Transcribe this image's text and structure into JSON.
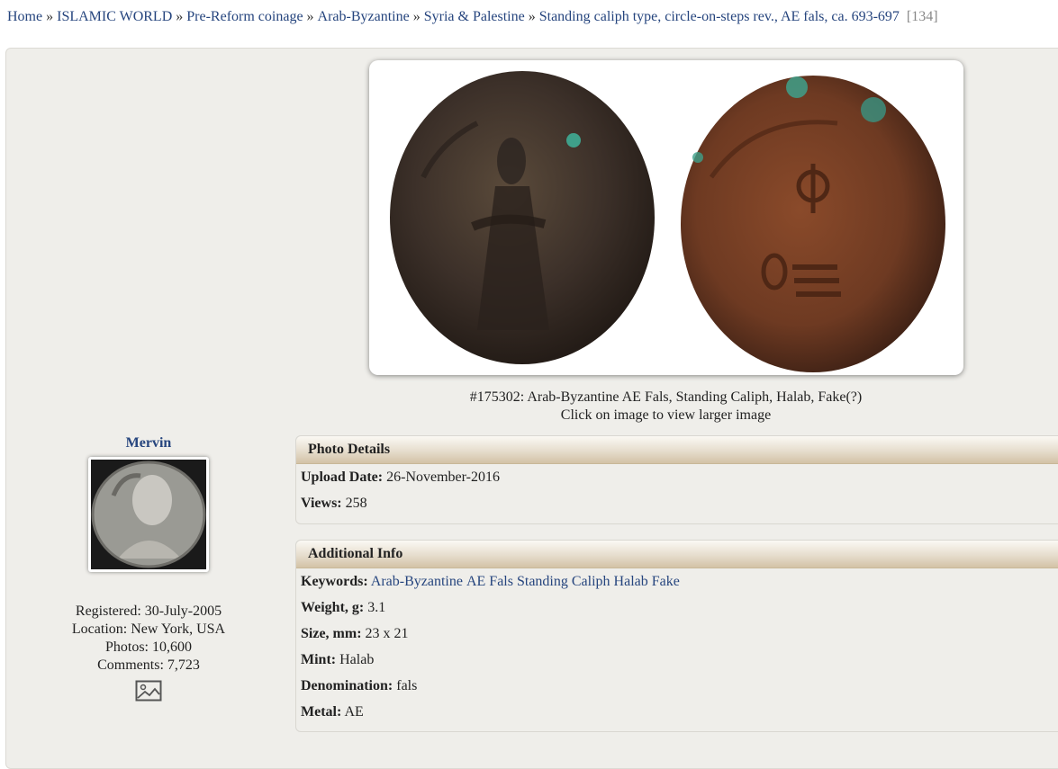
{
  "breadcrumb": {
    "items": [
      "Home",
      "ISLAMIC WORLD",
      "Pre-Reform coinage",
      "Arab-Byzantine",
      "Syria & Palestine",
      "Standing caliph type, circle-on-steps rev., AE fals, ca. 693-697"
    ],
    "separator": "»",
    "count": "[134]"
  },
  "photo": {
    "caption": "#175302: Arab-Byzantine AE Fals, Standing Caliph, Halab, Fake(?)",
    "hint": "Click on image to view larger image"
  },
  "user": {
    "name": "Mervin",
    "registered": "Registered: 30-July-2005",
    "location": "Location: New York, USA",
    "photos": "Photos: 10,600",
    "comments": "Comments: 7,723"
  },
  "photo_details": {
    "title": "Photo Details",
    "upload_label": "Upload Date:",
    "upload_value": "26-November-2016",
    "views_label": "Views:",
    "views_value": "258"
  },
  "additional_info": {
    "title": "Additional Info",
    "keywords_label": "Keywords:",
    "keywords": [
      "Arab-Byzantine",
      "AE",
      "Fals",
      "Standing",
      "Caliph",
      "Halab",
      "Fake"
    ],
    "weight_label": "Weight, g:",
    "weight_value": "3.1",
    "size_label": "Size, mm:",
    "size_value": "23 x 21",
    "mint_label": "Mint:",
    "mint_value": "Halab",
    "denom_label": "Denomination:",
    "denom_value": "fals",
    "metal_label": "Metal:",
    "metal_value": "AE"
  },
  "colors": {
    "link": "#26457e",
    "panel_bg": "#efeeea",
    "header_gradient_end": "#d3c2a6"
  }
}
